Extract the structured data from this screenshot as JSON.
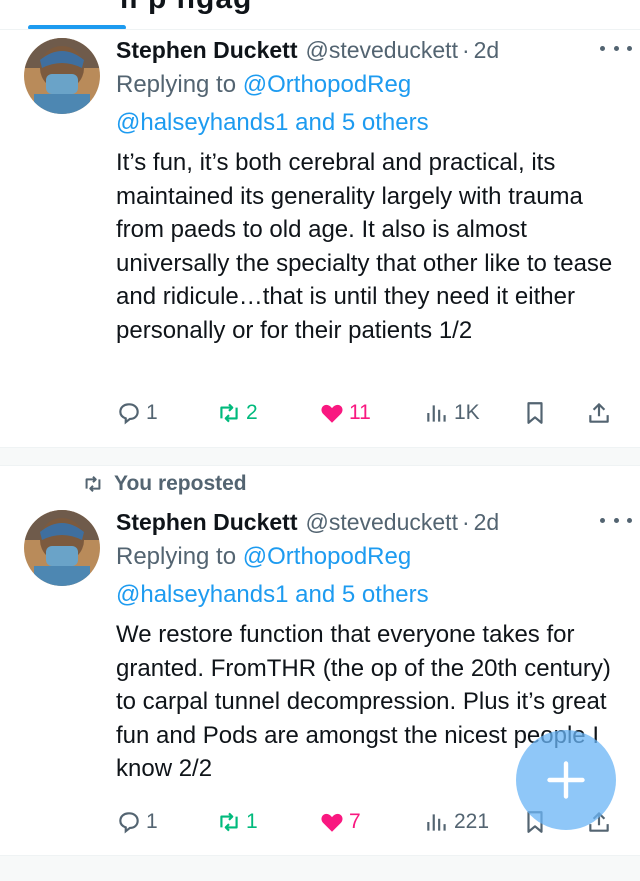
{
  "header": {
    "partial_title": "ll  p  ngag"
  },
  "posts": [
    {
      "repost_label": "",
      "author_name": "Stephen Duckett",
      "handle": "@steveduckett",
      "separator": "·",
      "time": "2d",
      "reply_prefix": "Replying to",
      "reply_to": "@OrthopodReg",
      "reply_others": "@halseyhands1 and 5 others",
      "text": "It’s fun, it’s both cerebral and practical, its maintained its generality largely with trauma from paeds to old age. It also is almost universally the specialty that other like to tease and ridicule…that is until they need it either personally or for their patients 1/2",
      "replies": "1",
      "reposts": "2",
      "likes": "11",
      "views": "1K",
      "reposted_by_me": false,
      "liked": true
    },
    {
      "repost_label": "You reposted",
      "author_name": "Stephen Duckett",
      "handle": "@steveduckett",
      "separator": "·",
      "time": "2d",
      "reply_prefix": "Replying to",
      "reply_to": "@OrthopodReg",
      "reply_others": "@halseyhands1 and 5 others",
      "text": "We restore function that everyone takes for granted. FromTHR (the op of the 20th century) to carpal tunnel decompression. Plus it’s great fun and Pods are amongst the nicest people I know 2/2",
      "replies": "1",
      "reposts": "1",
      "likes": "7",
      "views": "221",
      "reposted_by_me": true,
      "liked": true
    }
  ],
  "icons": {
    "reply": "reply-icon",
    "repost": "repost-icon",
    "like": "heart-icon",
    "views": "views-icon",
    "bookmark": "bookmark-icon",
    "share": "share-icon",
    "more": "more-icon",
    "compose": "plus-icon"
  },
  "colors": {
    "accent": "#1d9bf0",
    "repost_green": "#00ba7c",
    "like_pink": "#f91880",
    "secondary_text": "#536471"
  }
}
